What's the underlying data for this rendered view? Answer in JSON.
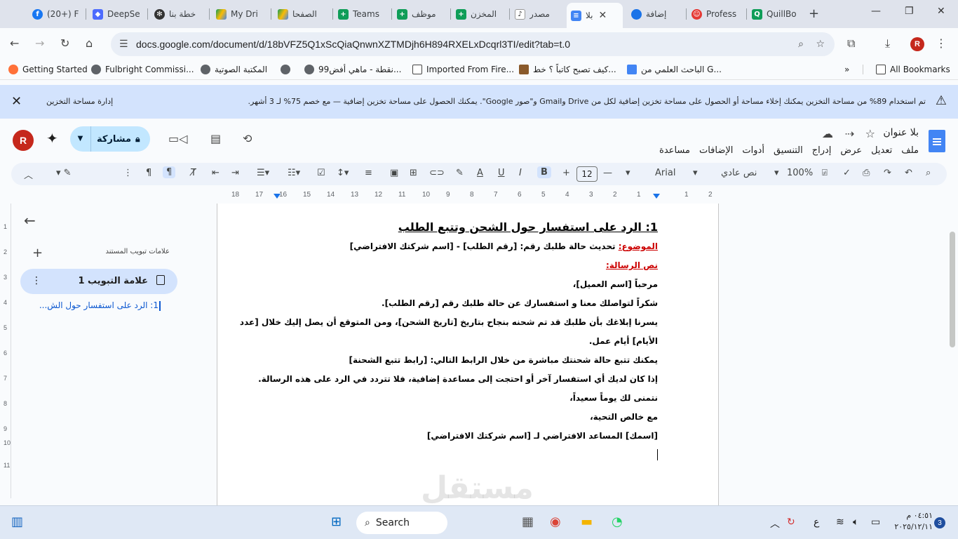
{
  "browser": {
    "tabs": [
      {
        "title": "(20+) F",
        "color": "#1877f2",
        "icon": "facebook-icon"
      },
      {
        "title": "DeepSe",
        "color": "#4d6bfe",
        "icon": "deepseek-icon"
      },
      {
        "title": "خطة بنا",
        "color": "#10a37f",
        "icon": "chatgpt-icon"
      },
      {
        "title": "My Dri",
        "color": "#fbbc04",
        "icon": "drive-icon"
      },
      {
        "title": "الصفحا",
        "color": "#fbbc04",
        "icon": "drive-icon"
      },
      {
        "title": "Teams",
        "color": "#0f9d58",
        "icon": "sheets-icon"
      },
      {
        "title": "موظف",
        "color": "#0f9d58",
        "icon": "sheets-icon"
      },
      {
        "title": "المخزن",
        "color": "#0f9d58",
        "icon": "sheets-icon"
      },
      {
        "title": "مصدر",
        "color": "#5f6368",
        "icon": "mostaql-icon"
      },
      {
        "title": "بلا",
        "color": "#4285f4",
        "icon": "docs-icon"
      },
      {
        "title": "إضافة",
        "color": "#1a73e8",
        "icon": "circle-icon"
      },
      {
        "title": "Profess",
        "color": "#e53935",
        "icon": "profess-icon"
      },
      {
        "title": "QuillBo",
        "color": "#0f9d58",
        "icon": "quillbot-icon"
      }
    ],
    "url": "docs.google.com/document/d/18bVFZ5Q1xScQiaQnwnXZTMDjh6H894RXELxDcqrl3TI/edit?tab=t.0",
    "profile_initial": "R"
  },
  "bookmarks": {
    "items": [
      "Getting Started",
      "Fulbright Commissi...",
      "المكتبة الصوتية",
      "",
      "99نقطة - ماهي أفض...",
      "Imported From Fire...",
      "كيف تصبح كاتباً ؟ خط...",
      "الباحث العلمي من G..."
    ],
    "all": "All Bookmarks"
  },
  "banner": {
    "manage": "إدارة مساحة التخزين",
    "message": "تم استخدام 89% من مساحة التخزين   يمكنك إخلاء مساحة أو الحصول على مساحة تخزين إضافية لكل من Drive وGmail و\"صور Google\". يمكنك الحصول على مساحة تخزين إضافية — مع خصم 75% لـ 3 أشهر."
  },
  "docs": {
    "title": "بلا عنوان",
    "menu": [
      "ملف",
      "تعديل",
      "عرض",
      "إدراج",
      "التنسيق",
      "أدوات",
      "الإضافات",
      "مساعدة"
    ],
    "share_label": "مشاركة",
    "avatar_initial": "R"
  },
  "toolbar": {
    "zoom": "100%",
    "style": "نص عادي",
    "font": "Arial",
    "font_size": "12",
    "bold": "B",
    "italic": "I",
    "underline": "U",
    "text_color": "A"
  },
  "ruler": [
    "18",
    "17",
    "16",
    "15",
    "14",
    "13",
    "12",
    "11",
    "10",
    "9",
    "8",
    "7",
    "6",
    "5",
    "4",
    "3",
    "2",
    "1",
    "",
    "1",
    "2"
  ],
  "vruler": [
    "1",
    "2",
    "3",
    "4",
    "5",
    "6",
    "7",
    "8",
    "9",
    "10",
    "11"
  ],
  "sidebar": {
    "heading": "علامات تبويب المستند",
    "tab_label": "علامة التبويب 1",
    "outline_item": "1: الرد على استفسار حول الش..."
  },
  "document": {
    "heading": "1: الرد على استفسار حول الشحن وتتبع الطلب",
    "subject_label": "الموضوع:",
    "subject_text": " تحديث حالة طلبك رقم: [رقم الطلب] - [اسم شركتك الافتراضي]",
    "body_label": "نص الرسالة:",
    "lines": [
      "مرحباً [اسم العميل]،",
      "شكراً لتواصلك معنا و استفسارك عن حالة طلبك رقم [رقم الطلب].",
      "يسرنا إبلاغك بأن طلبك قد تم شحنه بنجاح بتاريخ [تاريخ الشحن]، ومن المتوقع أن يصل إليك خلال [عدد",
      "الأيام] أيام عمل.",
      "يمكنك تتبع حالة شحنتك مباشرة من خلال الرابط التالي: [رابط تتبع الشحنة]",
      "إذا كان لديك أي استفسار آخر أو احتجت إلى مساعدة إضافية، فلا تتردد في الرد على هذه الرسالة.",
      "نتمنى لك يوماً سعيداً،",
      "مع خالص التحية،",
      "[اسمك] المساعد الافتراضي لـ [اسم شركتك الافتراضي]"
    ],
    "watermark": "مستقل"
  },
  "taskbar": {
    "search": "Search",
    "lang": "ع",
    "time": "٠٤:٥١ م",
    "date": "٢٠٢٥/١٢/١١",
    "notifications": "3"
  }
}
